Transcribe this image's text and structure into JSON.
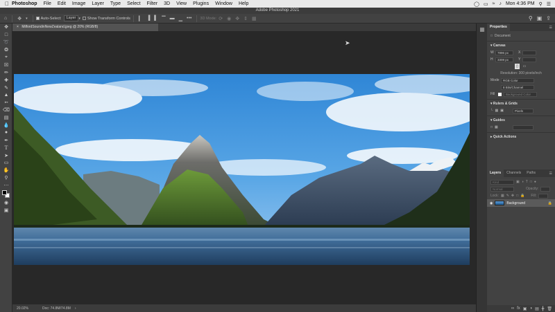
{
  "menubar": {
    "app": "Photoshop",
    "items": [
      "File",
      "Edit",
      "Image",
      "Layer",
      "Type",
      "Select",
      "Filter",
      "3D",
      "View",
      "Plugins",
      "Window",
      "Help"
    ],
    "clock": "Mon 4:36 PM"
  },
  "window": {
    "title": "Adobe Photoshop 2021"
  },
  "options": {
    "auto_select_label": "Auto-Select:",
    "auto_select_value": "Layer",
    "transform_label": "Show Transform Controls",
    "mode_3d": "3D Mode:"
  },
  "document": {
    "tab": "MilfordSoundinNewZealand.jpeg @ 20% (RGB/8)",
    "zoom": "20.02%",
    "doc_size": "Doc: 74.8M/74.8M"
  },
  "properties": {
    "tab": "Properties",
    "document_label": "Document",
    "canvas_header": "Canvas",
    "w_label": "W",
    "w_value": "7896 px",
    "x_label": "X",
    "h_label": "H",
    "h_value": "3308 px",
    "y_label": "Y",
    "resolution": "Resolution: 300 pixels/inch",
    "mode_label": "Mode",
    "mode_value": "RGB Color",
    "depth_value": "8 Bits/Channel",
    "fill_label": "Fill",
    "fill_value": "Background Color",
    "rulers_header": "Rulers & Grids",
    "units_value": "Pixels",
    "guides_header": "Guides",
    "quick_actions_header": "Quick Actions"
  },
  "layers": {
    "tabs": [
      "Layers",
      "Channels",
      "Paths"
    ],
    "kind_placeholder": "Kind",
    "blend_mode": "Normal",
    "opacity_label": "Opacity:",
    "lock_label": "Lock:",
    "fill_label": "Fill:",
    "layer_name": "Background"
  }
}
